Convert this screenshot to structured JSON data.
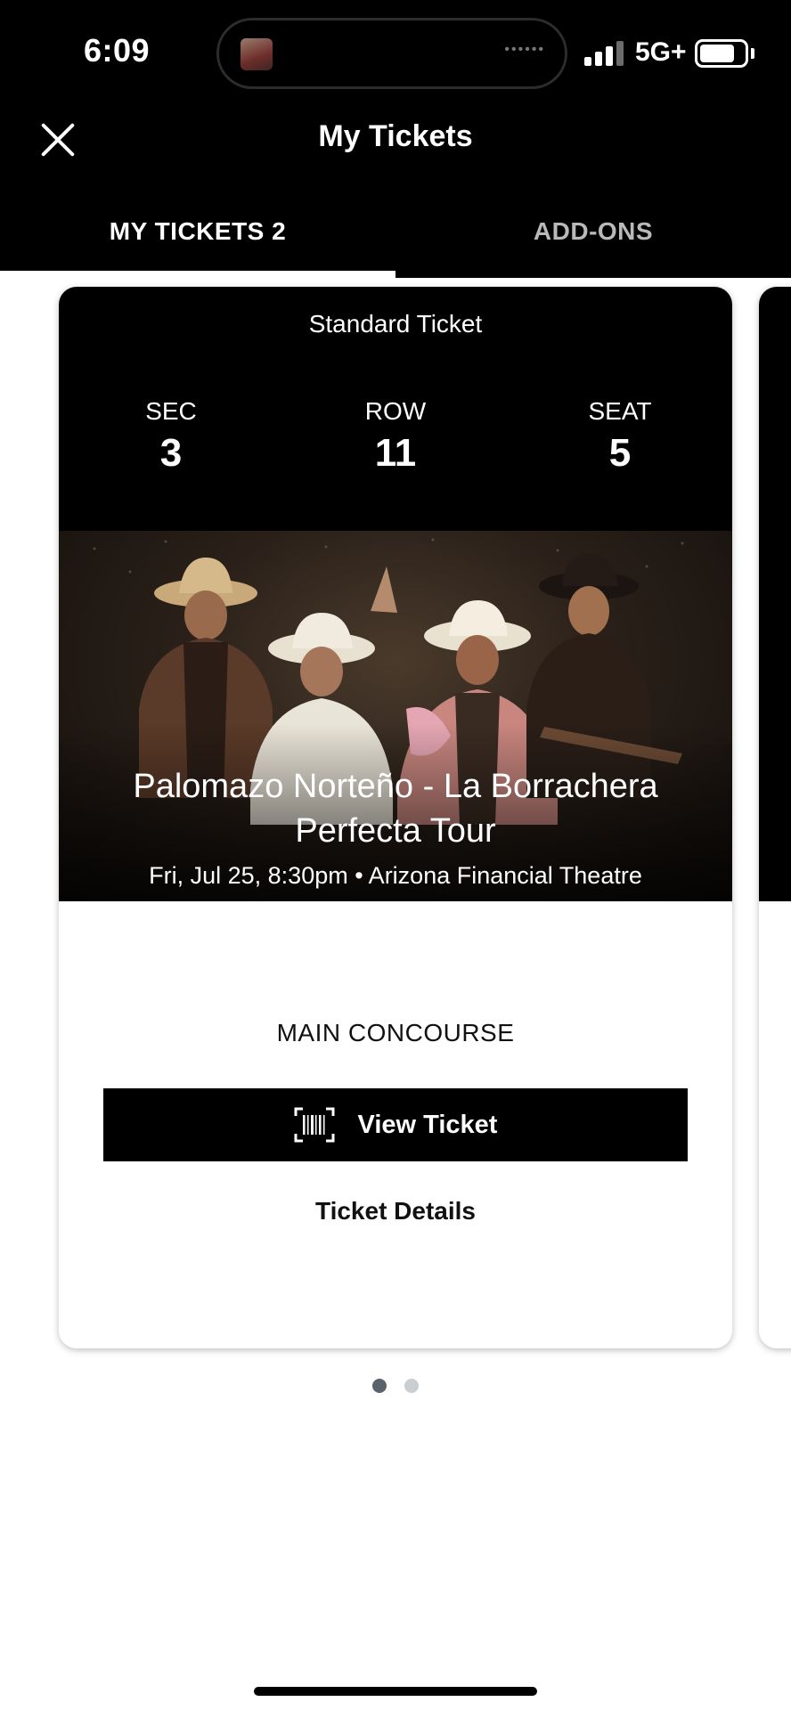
{
  "status_bar": {
    "time": "6:09",
    "network": "5G+",
    "battery_level": 0.8,
    "signal_bars": 3
  },
  "header": {
    "title": "My Tickets",
    "close_icon": "close-icon"
  },
  "tabs": [
    {
      "label": "MY TICKETS 2",
      "active": true
    },
    {
      "label": "ADD-ONS",
      "active": false
    }
  ],
  "ticket": {
    "type": "Standard Ticket",
    "sec_label": "SEC",
    "sec_value": "3",
    "row_label": "ROW",
    "row_value": "11",
    "seat_label": "SEAT",
    "seat_value": "5",
    "event_title": "Palomazo Norteño - La Borrachera Perfecta Tour",
    "event_meta": "Fri, Jul 25, 8:30pm • Arizona Financial Theatre",
    "area": "MAIN CONCOURSE",
    "view_button_label": "View Ticket",
    "details_label": "Ticket Details"
  },
  "pagination": {
    "current": 1,
    "total": 2
  },
  "colors": {
    "background_dark": "#000000",
    "card_bg": "#ffffff",
    "tab_inactive": "#b9b9b9",
    "dot_active": "#5a636b",
    "dot_inactive": "#c9ced3"
  }
}
